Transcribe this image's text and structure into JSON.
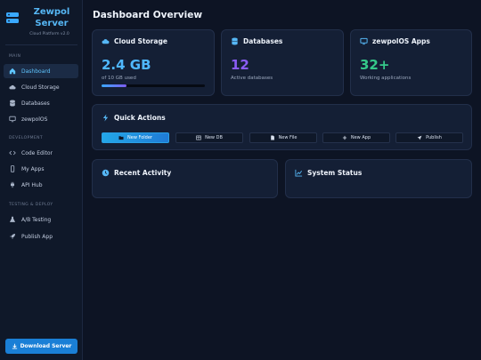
{
  "brand": {
    "title_line1": "Zewpol",
    "title_line2": "Server",
    "subtitle": "Cloud Platform v2.0"
  },
  "sidebar": {
    "sections": [
      {
        "label": "MAIN"
      },
      {
        "label": "DEVELOPMENT"
      },
      {
        "label": "TESTING & DEPLOY"
      }
    ],
    "items": [
      {
        "label": "Dashboard",
        "icon": "home-icon"
      },
      {
        "label": "Cloud Storage",
        "icon": "cloud-icon"
      },
      {
        "label": "Databases",
        "icon": "database-icon"
      },
      {
        "label": "zewpolOS",
        "icon": "monitor-icon"
      },
      {
        "label": "Code Editor",
        "icon": "code-icon"
      },
      {
        "label": "My Apps",
        "icon": "mobile-icon"
      },
      {
        "label": "API Hub",
        "icon": "plug-icon"
      },
      {
        "label": "A/B Testing",
        "icon": "flask-icon"
      },
      {
        "label": "Publish App",
        "icon": "rocket-icon"
      }
    ],
    "download_label": "Download Server"
  },
  "main": {
    "title": "Dashboard Overview",
    "cards": {
      "storage": {
        "title": "Cloud Storage",
        "value": "2.4 GB",
        "note": "of 10 GB used",
        "progress": 0.24
      },
      "databases": {
        "title": "Databases",
        "value": "12",
        "note": "Active databases"
      },
      "apps": {
        "title": "zewpolOS Apps",
        "value": "32+",
        "note": "Working applications"
      }
    },
    "quick_actions": {
      "title": "Quick Actions",
      "buttons": [
        {
          "label": "New Folder",
          "icon": "folder-icon"
        },
        {
          "label": "New DB",
          "icon": "table-icon"
        },
        {
          "label": "New File",
          "icon": "file-icon"
        },
        {
          "label": "New App",
          "icon": "plus-icon"
        },
        {
          "label": "Publish",
          "icon": "send-icon"
        }
      ]
    },
    "recent_activity": {
      "title": "Recent Activity"
    },
    "system_status": {
      "title": "System Status"
    }
  },
  "colors": {
    "accent": "#5fc6ff",
    "storage_value": "#4fb8ff",
    "databases_value": "#8a5cf6",
    "apps_value": "#35c98a"
  }
}
